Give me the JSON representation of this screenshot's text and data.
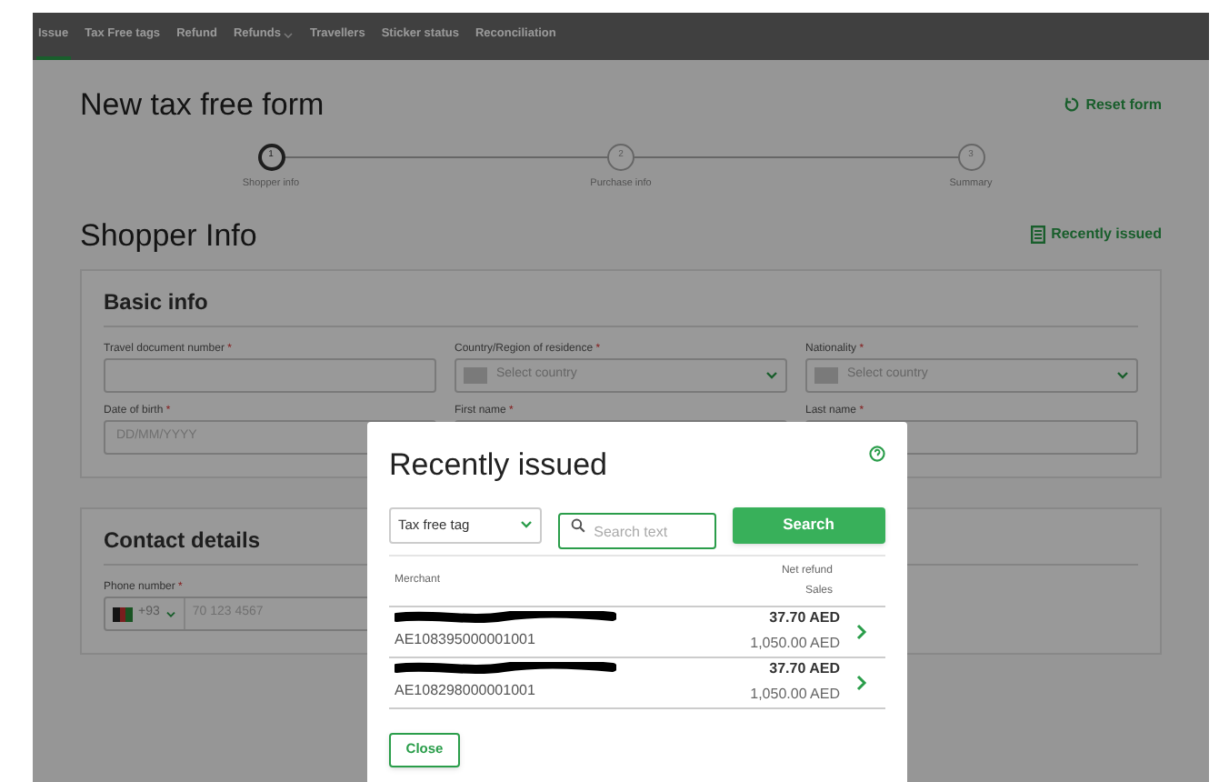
{
  "nav": {
    "items": [
      {
        "label": "Issue",
        "selected": true,
        "dropdown": false
      },
      {
        "label": "Tax Free tags",
        "selected": false,
        "dropdown": false
      },
      {
        "label": "Refund",
        "selected": false,
        "dropdown": false
      },
      {
        "label": "Refunds",
        "selected": false,
        "dropdown": true
      },
      {
        "label": "Travellers",
        "selected": false,
        "dropdown": false
      },
      {
        "label": "Sticker status",
        "selected": false,
        "dropdown": false
      },
      {
        "label": "Reconciliation",
        "selected": false,
        "dropdown": false
      }
    ]
  },
  "page": {
    "title": "New tax free form",
    "reset_link": "Reset form"
  },
  "stepper": {
    "steps": [
      {
        "number": "1",
        "label": "Shopper info",
        "selected": true
      },
      {
        "number": "2",
        "label": "Purchase info",
        "selected": false
      },
      {
        "number": "3",
        "label": "Summary",
        "selected": false
      }
    ]
  },
  "section": {
    "title": "Shopper Info",
    "recently_issued_link": "Recently issued"
  },
  "basic_info": {
    "title": "Basic info",
    "fields": [
      {
        "label": "Travel document number",
        "required_mark": "*",
        "kind": "text"
      },
      {
        "label": "Country/Region of residence",
        "required_mark": "*",
        "kind": "country",
        "placeholder": "Select country"
      },
      {
        "label": "Nationality",
        "required_mark": "*",
        "kind": "country",
        "placeholder": "Select country"
      },
      {
        "label": "Date of birth",
        "required_mark": "*",
        "kind": "text",
        "placeholder": "DD/MM/YYYY"
      },
      {
        "label": "First name",
        "required_mark": "*",
        "kind": "text"
      },
      {
        "label": "Last name",
        "required_mark": "*",
        "kind": "text"
      }
    ]
  },
  "contact_details": {
    "title": "Contact details",
    "fields": [
      {
        "label": "Phone number",
        "required_mark": "*",
        "kind": "phone",
        "code": "+93",
        "placeholder": "70 123 4567"
      }
    ]
  },
  "modal": {
    "title": "Recently issued",
    "type_select": "Tax free tag",
    "search": {
      "placeholder": "Search text"
    },
    "search_button": "Search",
    "columns": {
      "merchant": "Merchant",
      "amounts": [
        "Net refund",
        "Sales"
      ]
    },
    "rows": [
      {
        "id": "AE108395000001001",
        "net_refund": "37.70 AED",
        "sales": "1,050.00 AED"
      },
      {
        "id": "AE108298000001001",
        "net_refund": "37.70 AED",
        "sales": "1,050.00 AED"
      }
    ],
    "close_button": "Close"
  }
}
